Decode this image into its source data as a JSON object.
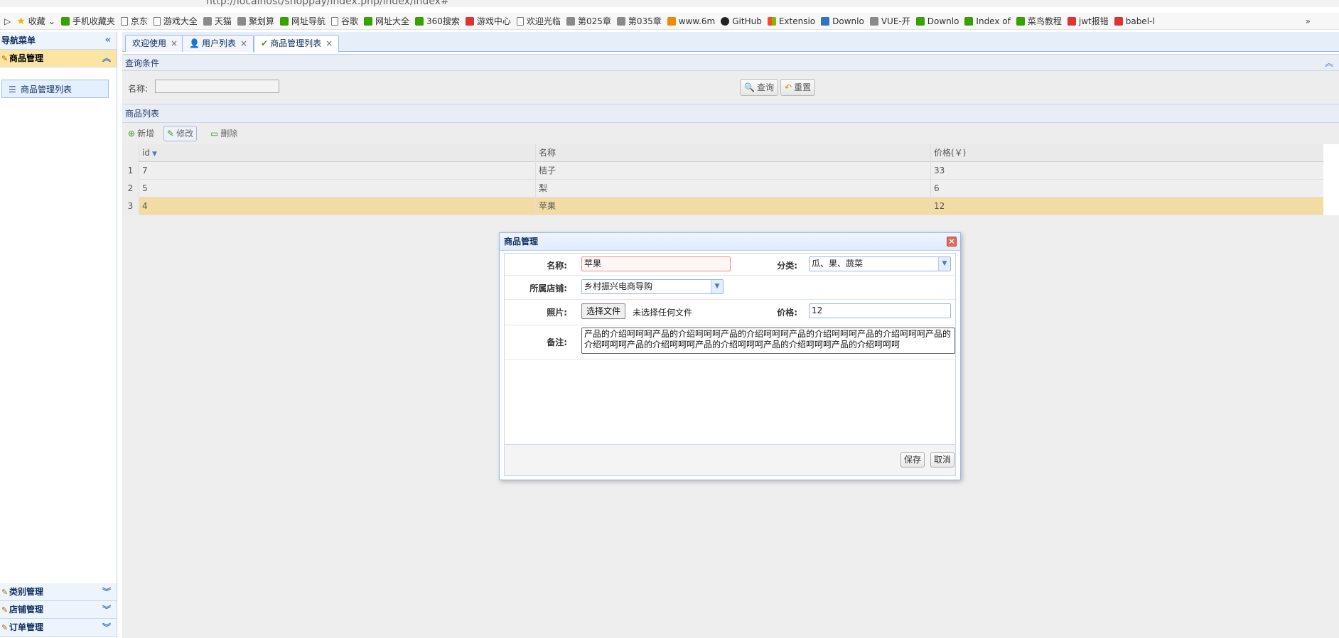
{
  "browser": {
    "address": "http://localhost/shoppay/index.php/index/index#",
    "bookmarks": [
      {
        "label": "收藏",
        "icon": "star-icon"
      },
      {
        "label": "手机收藏夹",
        "icon": "phone-icon"
      },
      {
        "label": "京东",
        "icon": "page-icon"
      },
      {
        "label": "游戏大全",
        "icon": "page-icon"
      },
      {
        "label": "天猫",
        "icon": "tmall-icon"
      },
      {
        "label": "聚划算",
        "icon": "juhuasuan-icon"
      },
      {
        "label": "网址导航",
        "icon": "navigation-icon"
      },
      {
        "label": "谷歌",
        "icon": "page-icon"
      },
      {
        "label": "网址大全",
        "icon": "navigation-icon"
      },
      {
        "label": "360搜索",
        "icon": "search-360-icon"
      },
      {
        "label": "游戏中心",
        "icon": "game-icon"
      },
      {
        "label": "欢迎光临",
        "icon": "page-icon"
      },
      {
        "label": "第025章",
        "icon": "book-icon"
      },
      {
        "label": "第035章",
        "icon": "book-icon"
      },
      {
        "label": "www.6m",
        "icon": "flame-icon"
      },
      {
        "label": "GitHub",
        "icon": "github-icon"
      },
      {
        "label": "Extensio",
        "icon": "microsoft-icon"
      },
      {
        "label": "Downlo",
        "icon": "vscode-icon"
      },
      {
        "label": "VUE-开",
        "icon": "vue-icon"
      },
      {
        "label": "Downlo",
        "icon": "node-icon"
      },
      {
        "label": "Index of",
        "icon": "node-icon"
      },
      {
        "label": "菜鸟教程",
        "icon": "runoob-icon"
      },
      {
        "label": "jwt报错",
        "icon": "csdn-icon"
      },
      {
        "label": "babel-l",
        "icon": "csdn-icon"
      }
    ],
    "more": "»"
  },
  "sidebar": {
    "title": "导航菜单",
    "sections": [
      {
        "label": "商品管理",
        "expanded": true,
        "items": [
          {
            "label": "商品管理列表"
          }
        ]
      },
      {
        "label": "类别管理",
        "expanded": false
      },
      {
        "label": "店铺管理",
        "expanded": false
      },
      {
        "label": "订单管理",
        "expanded": false
      }
    ]
  },
  "tabs": [
    {
      "label": "欢迎使用",
      "icon": ""
    },
    {
      "label": "用户列表",
      "icon": "user-icon"
    },
    {
      "label": "商品管理列表",
      "icon": "check-icon",
      "active": true
    }
  ],
  "query": {
    "title": "查询条件",
    "name_label": "名称:",
    "name_value": "",
    "search_label": "查询",
    "reset_label": "重置"
  },
  "list": {
    "title": "商品列表",
    "toolbar": {
      "add": "新增",
      "edit": "修改",
      "delete": "删除"
    },
    "columns": [
      "id",
      "名称",
      "价格(￥)"
    ],
    "rows": [
      {
        "n": "1",
        "id": "7",
        "name": "桔子",
        "price": "33"
      },
      {
        "n": "2",
        "id": "5",
        "name": "梨",
        "price": "6"
      },
      {
        "n": "3",
        "id": "4",
        "name": "苹果",
        "price": "12",
        "selected": true
      }
    ]
  },
  "dialog": {
    "title": "商品管理",
    "name_label": "名称:",
    "name_value": "苹果",
    "category_label": "分类:",
    "category_value": "瓜、果、蔬菜",
    "shop_label": "所属店铺:",
    "shop_value": "乡村振兴电商导购",
    "photo_label": "照片:",
    "file_button": "选择文件",
    "file_status": "未选择任何文件",
    "price_label": "价格:",
    "price_value": "12",
    "remark_label": "备注:",
    "remark_value": "产品的介绍呵呵呵产品的介绍呵呵呵产品的介绍呵呵呵产品的介绍呵呵呵产品的介绍呵呵呵产品的介绍呵呵呵产品的介绍呵呵呵产品的介绍呵呵呵产品的介绍呵呵呵产品的介绍呵呵呵",
    "save_label": "保存",
    "cancel_label": "取消"
  }
}
